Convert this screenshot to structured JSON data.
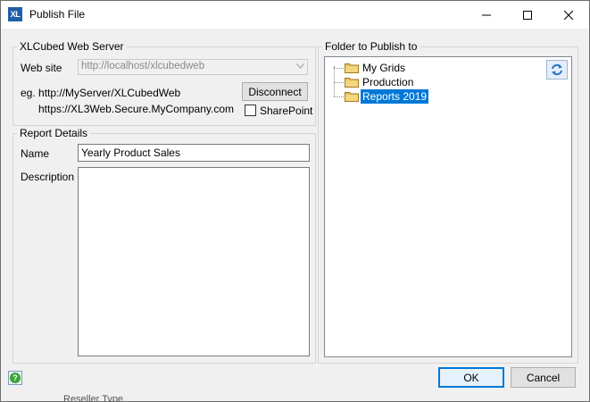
{
  "window": {
    "title": "Publish File",
    "app_icon_text": "XL"
  },
  "server_group": {
    "legend": "XLCubed Web Server",
    "website_label": "Web site",
    "website_value": "http://localhost/xlcubedweb",
    "example_line1": "eg. http://MyServer/XLCubedWeb",
    "example_line2": "https://XL3Web.Secure.MyCompany.com",
    "disconnect_label": "Disconnect",
    "sharepoint_label": "SharePoint",
    "sharepoint_checked": false
  },
  "report_group": {
    "legend": "Report Details",
    "name_label": "Name",
    "name_value": "Yearly Product Sales",
    "description_label": "Description",
    "description_value": ""
  },
  "folder_group": {
    "legend": "Folder to Publish to",
    "folders": [
      {
        "label": "My Grids",
        "selected": false
      },
      {
        "label": "Production",
        "selected": false
      },
      {
        "label": "Reports 2019",
        "selected": true
      }
    ]
  },
  "footer": {
    "ok_label": "OK",
    "cancel_label": "Cancel",
    "background_peek_text": "Reseller Type"
  },
  "colors": {
    "accent": "#0078d7",
    "selection": "#0078d7",
    "folder": "#e8c15a",
    "help": "#3aa635"
  },
  "icons": {
    "app": "xlcubed-logo-icon",
    "minimize": "minimize-icon",
    "maximize": "maximize-icon",
    "close": "close-icon",
    "dropdown": "chevron-down-icon",
    "folder": "folder-icon",
    "refresh": "refresh-icon",
    "help": "help-icon"
  }
}
